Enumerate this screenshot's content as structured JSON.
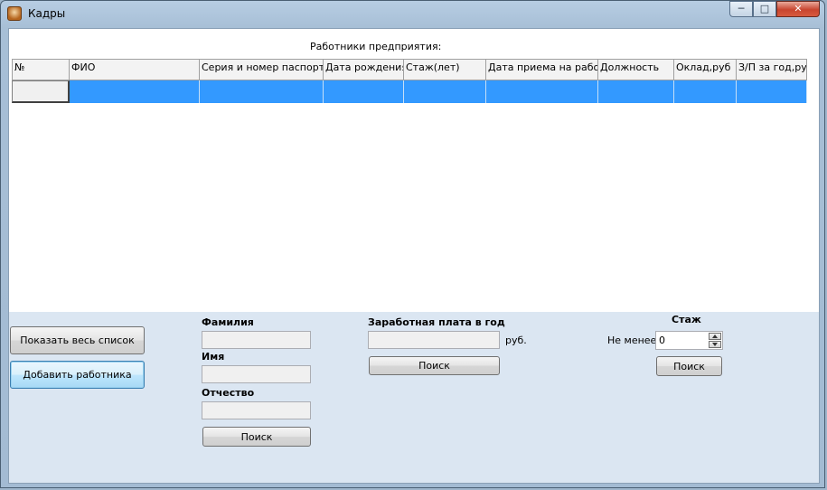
{
  "window": {
    "title": "Кадры"
  },
  "grid": {
    "title": "Работники предприятия:",
    "columns": [
      "№",
      "ФИО",
      "Серия и номер паспорта",
      "Дата рождения",
      "Стаж(лет)",
      "Дата приема на работу",
      "Должность",
      "Оклад,руб",
      "З/П за год,руб"
    ]
  },
  "buttons": {
    "show_all": "Показать весь список",
    "add_worker": "Добавить работника"
  },
  "name_search": {
    "last_name_label": "Фамилия",
    "first_name_label": "Имя",
    "patronymic_label": "Отчество",
    "last_name_value": "",
    "first_name_value": "",
    "patronymic_value": "",
    "search_button": "Поиск"
  },
  "salary_search": {
    "label": "Заработная плата в год",
    "unit": "руб.",
    "value": "",
    "search_button": "Поиск"
  },
  "experience_search": {
    "label": "Стаж",
    "min_label": "Не менее",
    "value": "0",
    "search_button": "Поиск"
  },
  "colors": {
    "selected_row": "#3399ff",
    "panel_background": "#dbe6f2"
  }
}
